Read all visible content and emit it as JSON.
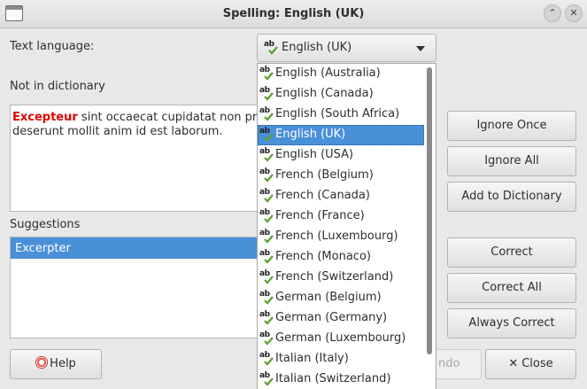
{
  "window": {
    "title": "Spelling: English (UK)"
  },
  "form": {
    "text_language_label": "Text language:",
    "language_value": "English (UK)",
    "not_in_dictionary_label": "Not in dictionary",
    "suggestions_label": "Suggestions"
  },
  "sentence": {
    "misspelled_word": "Excepteur",
    "rest_line1": " sint occaecat cupidatat non pro",
    "line2": "deserunt mollit anim id est laborum."
  },
  "suggestions": [
    "Excerpter"
  ],
  "buttons": {
    "ignore_once": "Ignore Once",
    "ignore_all": "Ignore All",
    "add_to_dictionary": "Add to Dictionary",
    "correct": "Correct",
    "correct_all": "Correct All",
    "always_correct": "Always Correct",
    "help": "Help",
    "undo_partial": "ndo",
    "close": "Close"
  },
  "languages": [
    "English (Australia)",
    "English (Canada)",
    "English (South Africa)",
    "English (UK)",
    "English (USA)",
    "French (Belgium)",
    "French (Canada)",
    "French (France)",
    "French (Luxembourg)",
    "French (Monaco)",
    "French (Switzerland)",
    "German (Belgium)",
    "German (Germany)",
    "German (Luxembourg)",
    "Italian (Italy)",
    "Italian (Switzerland)"
  ],
  "selected_language_index": 3,
  "icons": {
    "language": "spellcheck-abc-icon",
    "help": "help-lifebuoy-icon",
    "close": "close-x-icon",
    "window": "window-icon"
  },
  "colors": {
    "selection": "#4a90d9",
    "misspelled": "#e00000",
    "check": "#5aa02c"
  }
}
